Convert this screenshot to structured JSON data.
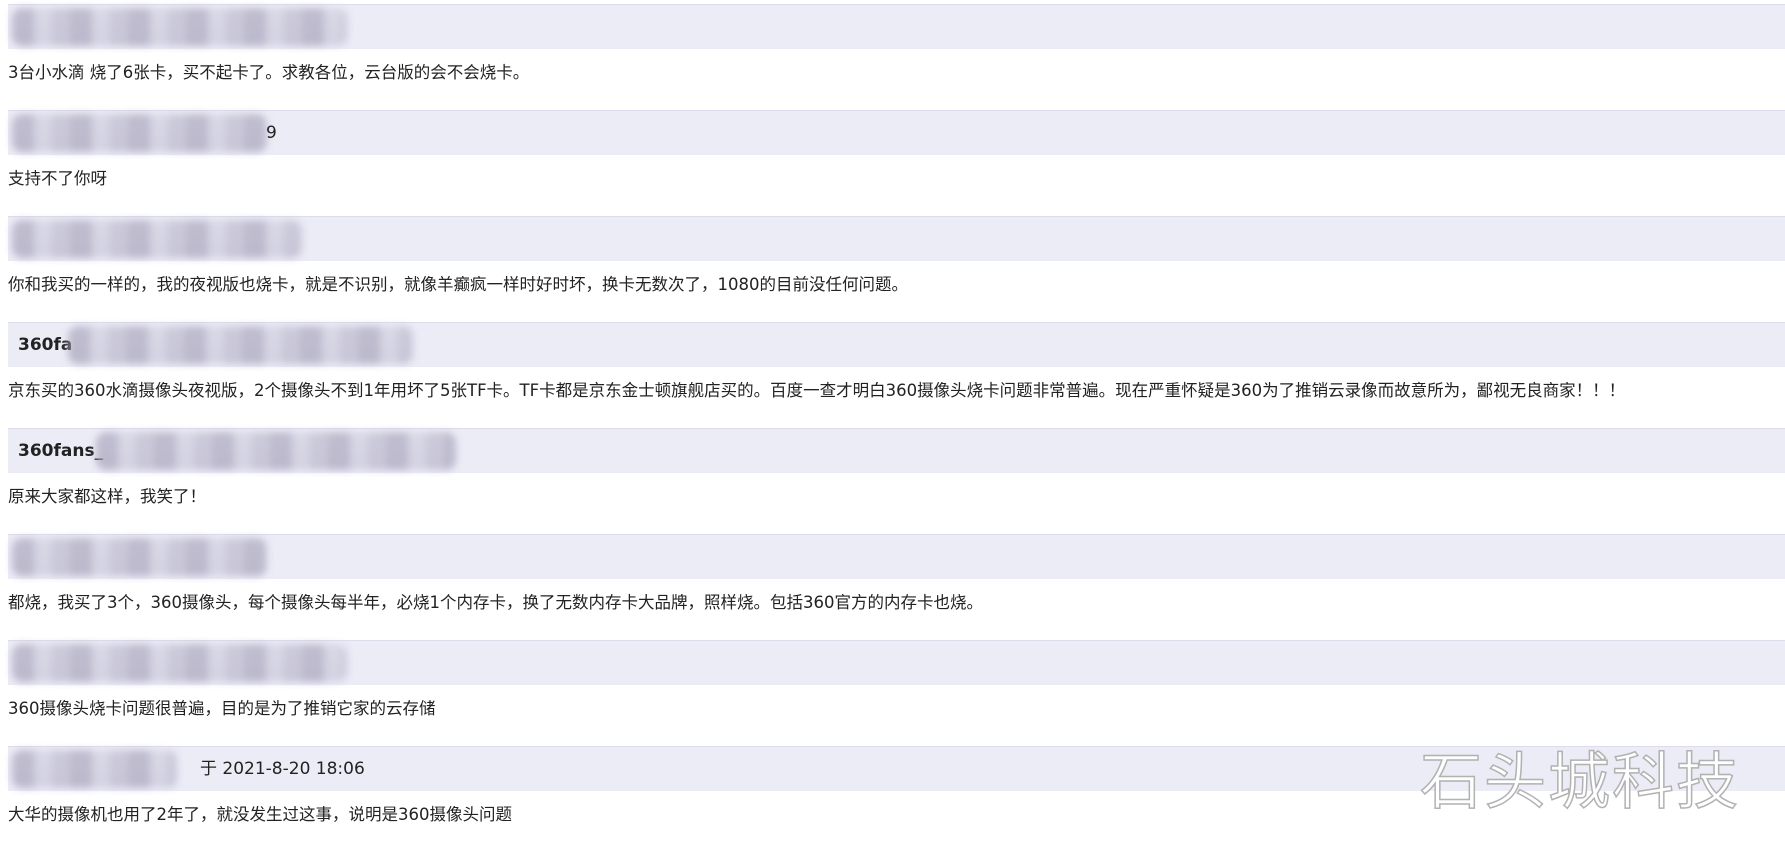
{
  "posts": [
    {
      "author_visible": "",
      "time": "",
      "text": "3台小水滴 烧了6张卡，买不起卡了。求教各位，云台版的会不会烧卡。"
    },
    {
      "author_visible": "",
      "time": "9",
      "text": "支持不了你呀"
    },
    {
      "author_visible": "",
      "time": "",
      "text": "你和我买的一样的，我的夜视版也烧卡，就是不识别，就像羊癫疯一样时好时坏，换卡无数次了，1080的目前没任何问题。"
    },
    {
      "author_visible": "360fa",
      "time": "",
      "text": "京东买的360水滴摄像头夜视版，2个摄像头不到1年用坏了5张TF卡。TF卡都是京东金士顿旗舰店买的。百度一查才明白360摄像头烧卡问题非常普遍。现在严重怀疑是360为了推销云录像而故意所为，鄙视无良商家！！！"
    },
    {
      "author_visible": "360fans_",
      "time": "",
      "text": "原来大家都这样，我笑了！"
    },
    {
      "author_visible": "",
      "time": "",
      "text": "都烧，我买了3个，360摄像头，每个摄像头每半年，必烧1个内存卡，换了无数内存卡大品牌，照样烧。包括360官方的内存卡也烧。"
    },
    {
      "author_visible": "",
      "time": "",
      "text": "360摄像头烧卡问题很普遍，目的是为了推销它家的云存储"
    },
    {
      "author_visible": "",
      "time": "于 2021-8-20 18:06",
      "text": "大华的摄像机也用了2年了，就没发生过这事，说明是360摄像头问题"
    }
  ],
  "watermark": "石头城科技"
}
